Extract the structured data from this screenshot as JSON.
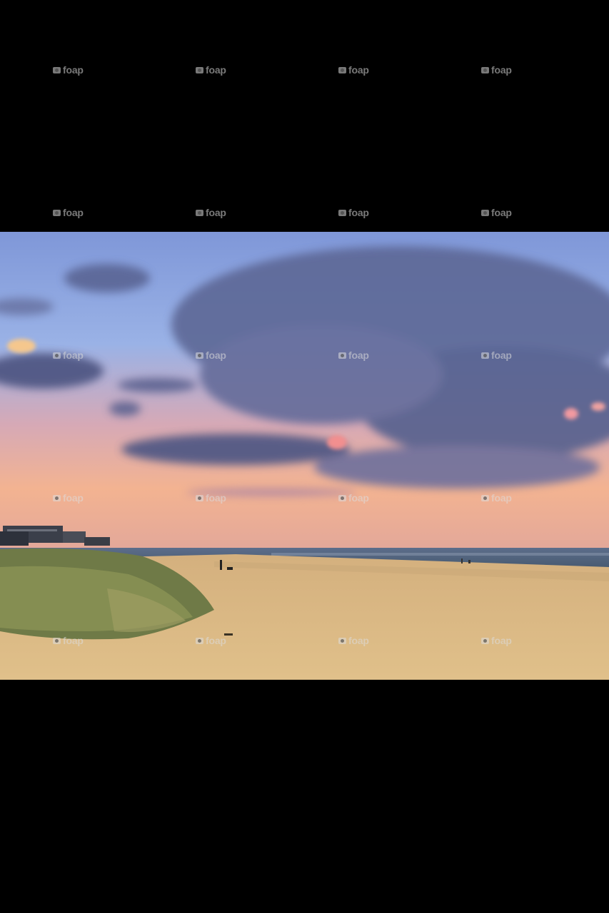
{
  "image": {
    "subject": "beach at sunset",
    "colors": {
      "sky_top": "#7f97d8",
      "sky_horizon": "#f3b391",
      "cloud": "#4a5280",
      "sand": "#d8b983",
      "sea": "#4a5f7d",
      "grass": "#6f7a47"
    }
  },
  "watermark": {
    "text": "foap",
    "icon": "camera-icon"
  }
}
